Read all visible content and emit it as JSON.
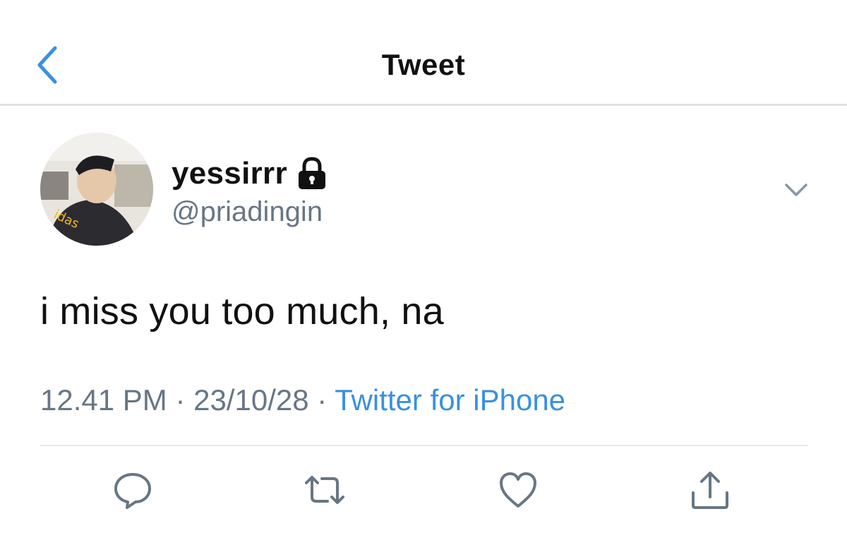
{
  "header": {
    "title": "Tweet",
    "back_icon": "chevron-left-icon",
    "accent_color": "#3a90e0"
  },
  "tweet": {
    "display_name": "yessirrr",
    "handle": "@priadingin",
    "protected_icon": "lock-icon",
    "text": "i miss you too much, na",
    "time": "12.41 PM",
    "date": "23/10/28",
    "separator": "·",
    "source": "Twitter for iPhone"
  },
  "actions": [
    {
      "name": "reply",
      "icon": "reply-icon"
    },
    {
      "name": "retweet",
      "icon": "retweet-icon"
    },
    {
      "name": "like",
      "icon": "heart-icon"
    },
    {
      "name": "share",
      "icon": "share-icon"
    }
  ]
}
